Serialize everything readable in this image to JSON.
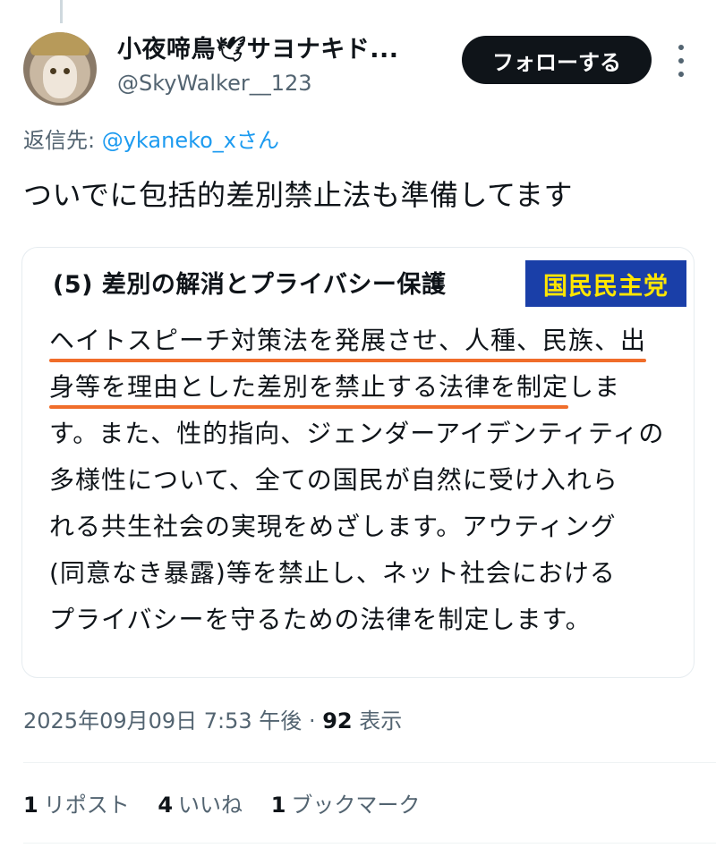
{
  "user": {
    "display_name": "小夜啼鳥🕊サヨナキド...",
    "handle": "@SkyWalker__123",
    "avatar_icon": "cat-avatar-icon"
  },
  "follow_label": "フォローする",
  "more_icon": "more-vertical-icon",
  "reply": {
    "prefix": "返信先: ",
    "mention": "@ykaneko_x",
    "suffix": "さん"
  },
  "tweet_text": "ついでに包括的差別禁止法も準備してます",
  "card": {
    "title": "(5) 差別の解消とプライバシー保護",
    "party": "国民民主党",
    "lines": [
      {
        "highlight": "ヘイトスピーチ対策法を発展させ、人種、民族、出",
        "rest": ""
      },
      {
        "highlight": "身等を理由とした差別を禁止する法律を制定",
        "rest": "しま"
      },
      {
        "highlight": "",
        "rest": "す。また、性的指向、ジェンダーアイデンティティの"
      },
      {
        "highlight": "",
        "rest": "多様性について、全ての国民が自然に受け入れら"
      },
      {
        "highlight": "",
        "rest": "れる共生社会の実現をめざします。アウティング"
      },
      {
        "highlight": "",
        "rest": "(同意なき暴露)等を禁止し、ネット社会における"
      },
      {
        "highlight": "",
        "rest": "プライバシーを守るための法律を制定します。"
      }
    ],
    "highlight_color": "#f06d2a",
    "badge_bg": "#1a3fa8",
    "badge_fg": "#ffe600"
  },
  "meta": {
    "timestamp": "2025年09月09日 7:53 午後",
    "separator": " · ",
    "views": "92",
    "views_label": " 表示"
  },
  "stats": {
    "reposts": {
      "count": "1",
      "label": "リポスト"
    },
    "likes": {
      "count": "4",
      "label": "いいね"
    },
    "bookmarks": {
      "count": "1",
      "label": "ブックマーク"
    }
  }
}
